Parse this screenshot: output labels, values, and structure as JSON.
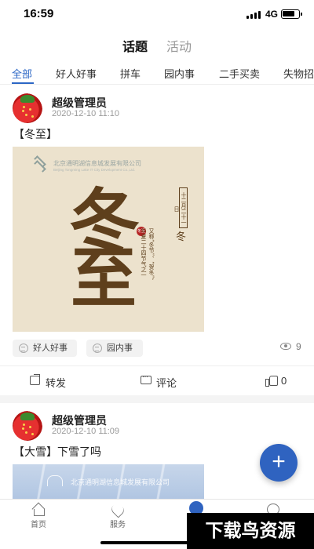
{
  "status_bar": {
    "time": "16:59",
    "network": "4G",
    "battery_level": 0.8
  },
  "top_tabs": [
    {
      "label": "话题",
      "active": true
    },
    {
      "label": "活动",
      "active": false
    }
  ],
  "categories": [
    {
      "label": "全部",
      "active": true
    },
    {
      "label": "好人好事",
      "active": false
    },
    {
      "label": "拼车",
      "active": false
    },
    {
      "label": "园内事",
      "active": false
    },
    {
      "label": "二手买卖",
      "active": false
    },
    {
      "label": "失物招",
      "active": false
    }
  ],
  "posts": [
    {
      "author": "超级管理员",
      "time": "2020-12-10 11:10",
      "title": "【冬至】",
      "image": {
        "company": "北京通明湖信息城发展有限公司",
        "company_en": "Beijing Tongming Lake IT City Development Co.,Ltd.",
        "big_chars": [
          "冬",
          "至"
        ],
        "date_box": "十二月二十一日",
        "side_char": "冬",
        "seal": "冬至",
        "caption_lines": [
          "又称“冬节”、“贺冬”，",
          "华夏二十四节气之一"
        ]
      },
      "tags": [
        "好人好事",
        "园内事"
      ],
      "views": "9",
      "actions": {
        "share": "转发",
        "comment": "评论",
        "likes": "0"
      }
    },
    {
      "author": "超级管理员",
      "time": "2020-12-10 11:09",
      "title": "【大雪】下雪了吗",
      "image": {
        "company": "北京通明湖信息城发展有限公司"
      }
    }
  ],
  "fab": {
    "label": "+"
  },
  "tab_bar": [
    {
      "label": "首页",
      "icon": "home-icon"
    },
    {
      "label": "服务",
      "icon": "heart-icon"
    },
    {
      "label": "",
      "icon": "community-icon"
    },
    {
      "label": "",
      "icon": "me-icon"
    }
  ],
  "watermark": "下载鸟资源"
}
